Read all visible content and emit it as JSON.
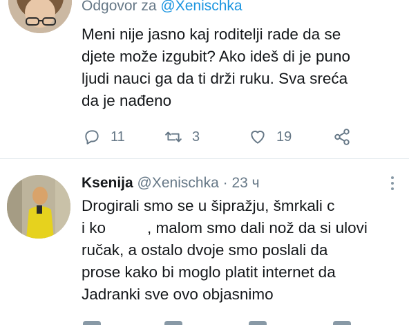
{
  "tweet1": {
    "reply_prefix": "Odgovor za",
    "reply_handle": "@Xenischka",
    "text": "Meni nije jasno kaj roditelji rade da se\ndjete može izgubit? Ako ideš di je puno\nljudi nauci ga da ti drži ruku. Sva sreća\nda je nađeno",
    "actions": {
      "reply_count": "11",
      "retweet_count": "3",
      "like_count": "19"
    }
  },
  "tweet2": {
    "name": "Ksenija",
    "handle": "@Xenischka",
    "separator": "·",
    "time": "23 ч",
    "text_part1": "Drogirali smo se u šipražju, šmrkali c\ni ko",
    "text_part2": ", malom smo dali nož da si ulovi\nručak, a ostalo dvoje smo poslali da\nprose kako bi moglo platit internet da\nJadranki sve ovo objasnimo"
  },
  "colors": {
    "text": "#14171a",
    "secondary": "#657786",
    "link": "#1b95e0",
    "divider": "#e1e8ed"
  },
  "icons": {
    "reply": "reply-icon",
    "retweet": "retweet-icon",
    "like": "heart-icon",
    "share": "share-icon",
    "more": "more-vertical-icon"
  }
}
